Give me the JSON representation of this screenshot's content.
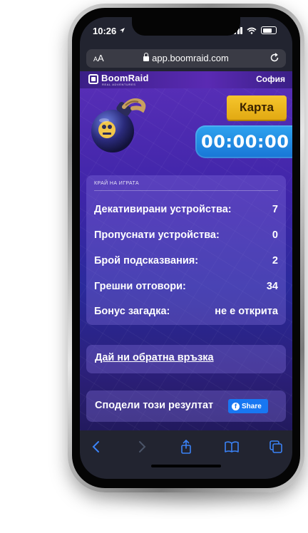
{
  "status_bar": {
    "time": "10:26"
  },
  "browser": {
    "aa_label": "AA",
    "url": "app.boomraid.com"
  },
  "header": {
    "brand": "BoomRaid",
    "brand_tagline": "REAL ADVENTURES",
    "city": "София"
  },
  "map_button": {
    "label": "Карта"
  },
  "timer": {
    "value": "00:00:00"
  },
  "stats": {
    "title": "КРАЙ НА ИГРАТА",
    "rows": [
      {
        "label": "Декативирани устройства:",
        "value": "7"
      },
      {
        "label": "Пропуснати устройства:",
        "value": "0"
      },
      {
        "label": "Брой подсказвания:",
        "value": "2"
      },
      {
        "label": "Грешни отговори:",
        "value": "34"
      },
      {
        "label": "Бонус загадка:",
        "value": "не е открита"
      }
    ]
  },
  "feedback": {
    "label": "Дай ни обратна връзка"
  },
  "share": {
    "label": "Сподели този резултат",
    "button_label": "Share"
  },
  "icons": [
    "location-arrow-icon",
    "signal-icon",
    "wifi-icon",
    "battery-icon",
    "lock-icon",
    "reload-icon",
    "bomb-icon",
    "facebook-icon",
    "back-icon",
    "forward-icon",
    "share-icon",
    "bookmarks-icon",
    "tabs-icon"
  ]
}
